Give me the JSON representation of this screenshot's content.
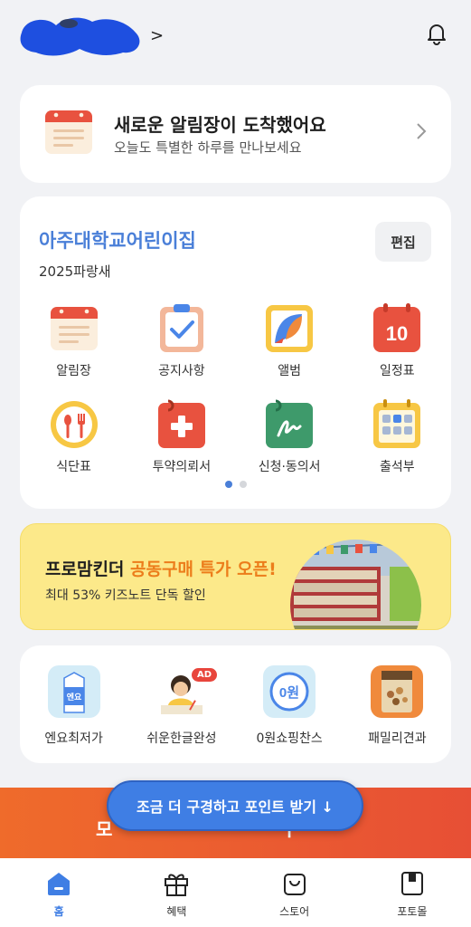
{
  "header": {
    "profile_chevron": ">"
  },
  "notice": {
    "title": "새로운 알림장이 도착했어요",
    "subtitle": "오늘도 특별한 하루를 만나보세요"
  },
  "school": {
    "name": "아주대학교어린이집",
    "class_name": "2025파랑새",
    "edit_label": "편집",
    "calendar_day": "10",
    "menu": [
      {
        "label": "알림장",
        "icon": "notebook-icon"
      },
      {
        "label": "공지사항",
        "icon": "clipboard-check-icon"
      },
      {
        "label": "앨범",
        "icon": "album-icon"
      },
      {
        "label": "일정표",
        "icon": "calendar-icon"
      },
      {
        "label": "식단표",
        "icon": "meal-plate-icon"
      },
      {
        "label": "투약의뢰서",
        "icon": "medicine-kit-icon"
      },
      {
        "label": "신청·동의서",
        "icon": "signature-form-icon"
      },
      {
        "label": "출석부",
        "icon": "attendance-grid-icon"
      }
    ],
    "pages_total": 2,
    "pages_current": 1
  },
  "banner": {
    "title_prefix": "프로맘킨더 ",
    "title_highlight": "공동구매 특가 오픈!",
    "subtitle": "최대 53% 키즈노트 단독 할인"
  },
  "shop": {
    "items": [
      {
        "label": "엔요최저가"
      },
      {
        "label": "쉬운한글완성"
      },
      {
        "label": "0원쇼핑찬스"
      },
      {
        "label": "패밀리견과"
      }
    ],
    "ad_badge": "AD",
    "zero_won_text": "0원",
    "milk_text": "엔요"
  },
  "promo": {
    "left_text": "모",
    "right_text": "구",
    "fab_label": "조금 더 구경하고 포인트 받기 ↓"
  },
  "tabbar": {
    "tabs": [
      {
        "label": "홈",
        "icon": "home-icon",
        "active": true
      },
      {
        "label": "혜택",
        "icon": "gift-icon",
        "active": false
      },
      {
        "label": "스토어",
        "icon": "shopping-bag-icon",
        "active": false
      },
      {
        "label": "포토몰",
        "icon": "photo-book-icon",
        "active": false
      }
    ]
  },
  "colors": {
    "accent": "#3f7ee4",
    "school_name": "#4a7fd8",
    "banner_bg": "#fce98a",
    "banner_highlight": "#ec7d1b",
    "promo_bg": "#ef6b2b"
  }
}
